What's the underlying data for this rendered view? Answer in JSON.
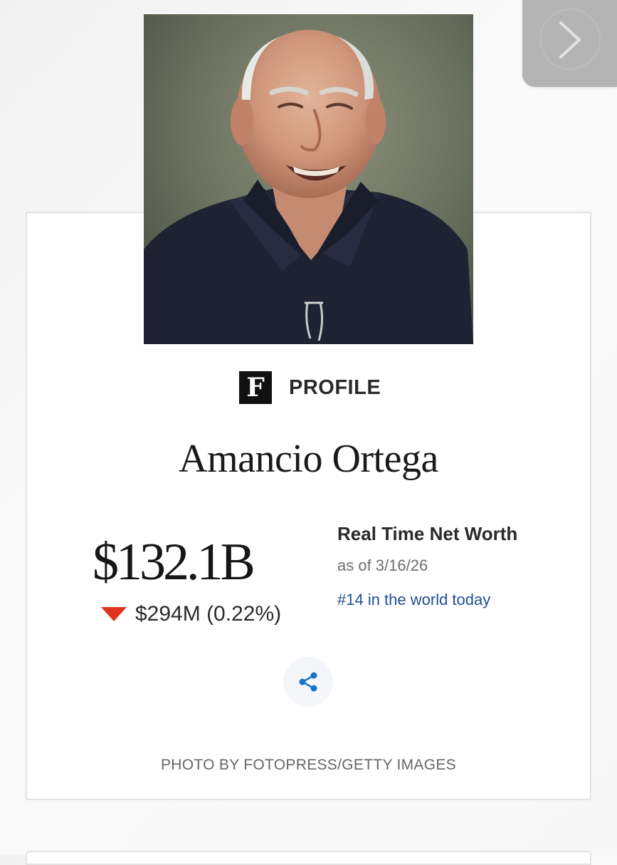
{
  "profile": {
    "brand_label": "PROFILE",
    "brand_logo_letter": "F",
    "name": "Amancio Ortega",
    "net_worth": "$132.1B",
    "change": "$294M (0.22%)",
    "change_direction": "down",
    "real_time_title": "Real Time Net Worth",
    "as_of": "as of 3/16/26",
    "rank": "#14 in the world today",
    "photo_credit": "PHOTO BY FOTOPRESS/GETTY IMAGES"
  },
  "colors": {
    "down_arrow": "#e0341f",
    "rank_link": "#1f4f93",
    "share_icon": "#1a73c9"
  },
  "icons": {
    "next": "chevron-right-icon",
    "share": "share-icon",
    "change": "triangle-down-icon"
  }
}
